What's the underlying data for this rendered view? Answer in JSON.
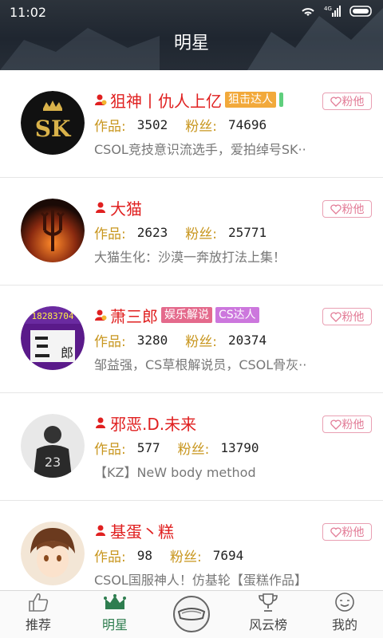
{
  "status": {
    "time": "11:02"
  },
  "header": {
    "title": "明星"
  },
  "users": [
    {
      "name": "狙神丨仇人上亿",
      "tags": [
        {
          "text": "狙击达人",
          "color": "#f2a93b"
        }
      ],
      "online": true,
      "works_label": "作品:",
      "works": "3502",
      "fans_label": "粉丝:",
      "fans": "74696",
      "desc": "CSOL竞技意识流选手，爱拍绰号SK··",
      "fan_button": "粉他",
      "badge": "gold"
    },
    {
      "name": "大猫",
      "tags": [],
      "online": false,
      "works_label": "作品:",
      "works": "2623",
      "fans_label": "粉丝:",
      "fans": "25771",
      "desc": "大猫生化：沙漠一奔放打法上集！",
      "fan_button": "粉他",
      "badge": "red"
    },
    {
      "name": "萧三郎",
      "tags": [
        {
          "text": "娱乐解说",
          "color": "#e46a8c"
        },
        {
          "text": "CS达人",
          "color": "#cc77dd"
        }
      ],
      "online": false,
      "works_label": "作品:",
      "works": "3280",
      "fans_label": "粉丝:",
      "fans": "20374",
      "desc": "邹益强，CS草根解说员，CSOL骨灰··",
      "fan_button": "粉他",
      "badge": "gold",
      "avatar_text": "18283704"
    },
    {
      "name": "邪恶.D.未来",
      "tags": [],
      "online": false,
      "works_label": "作品:",
      "works": "577",
      "fans_label": "粉丝:",
      "fans": "13790",
      "desc": "【KZ】NeW body method",
      "fan_button": "粉他",
      "badge": "red"
    },
    {
      "name": "基蛋丶糕",
      "tags": [],
      "online": false,
      "works_label": "作品:",
      "works": "98",
      "fans_label": "粉丝:",
      "fans": "7694",
      "desc": "CSOL国服神人！仿基轮【蛋糕作品】",
      "fan_button": "粉他",
      "badge": "red"
    }
  ],
  "tabs": [
    {
      "label": "推荐",
      "icon": "thumbs-up-icon",
      "active": false
    },
    {
      "label": "明星",
      "icon": "crown-icon",
      "active": true
    },
    {
      "label": "",
      "icon": "goggles-icon",
      "active": false
    },
    {
      "label": "风云榜",
      "icon": "trophy-icon",
      "active": false
    },
    {
      "label": "我的",
      "icon": "smiley-icon",
      "active": false
    }
  ],
  "colors": {
    "accent_red": "#e02020",
    "label_gold": "#c8961e",
    "active_green": "#2e7d4f",
    "fan_pink": "#e27b96"
  }
}
